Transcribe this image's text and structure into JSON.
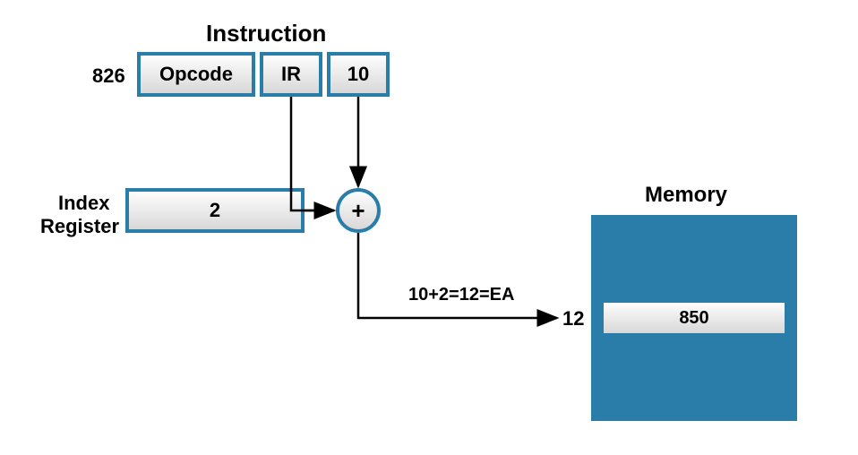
{
  "diagram": {
    "title": "Instruction",
    "instructionAddress": "826",
    "opcodeLabel": "Opcode",
    "irLabel": "IR",
    "displacementValue": "10",
    "indexRegisterLabel1": "Index",
    "indexRegisterLabel2": "Register",
    "indexRegisterValue": "2",
    "adderSymbol": "+",
    "eaCalc": "10+2=12=EA",
    "eaAddress": "12",
    "memoryTitle": "Memory",
    "memoryValue": "850"
  }
}
